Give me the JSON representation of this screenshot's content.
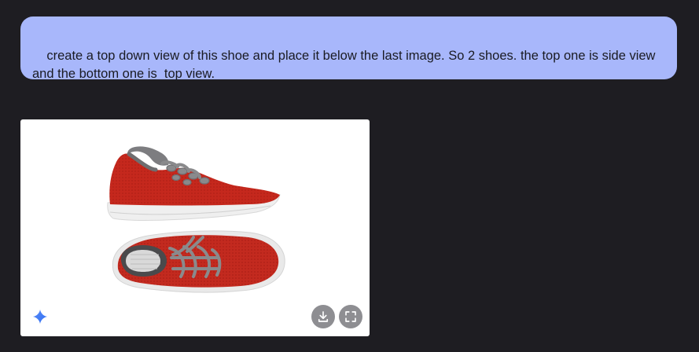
{
  "conversation": {
    "user_message": "create a top down view of this shoe and place it below the last image. So 2 shoes. the top one is side view and the bottom one is  top view."
  },
  "generated_image": {
    "alt": "Red knit sneaker shown in side view above and top-down view below",
    "actions": {
      "download_icon": "download-icon",
      "fullscreen_icon": "fullscreen-icon"
    },
    "badge_icon": "gemini-sparkle-icon"
  },
  "colors": {
    "page_background": "#1e1d22",
    "user_bubble": "#a8b7fb",
    "shoe_red": "#c22a1f",
    "lace_gray": "#8a8a8a",
    "sole_white": "#eeeeee",
    "sparkle_blue": "#3f7bf5"
  }
}
